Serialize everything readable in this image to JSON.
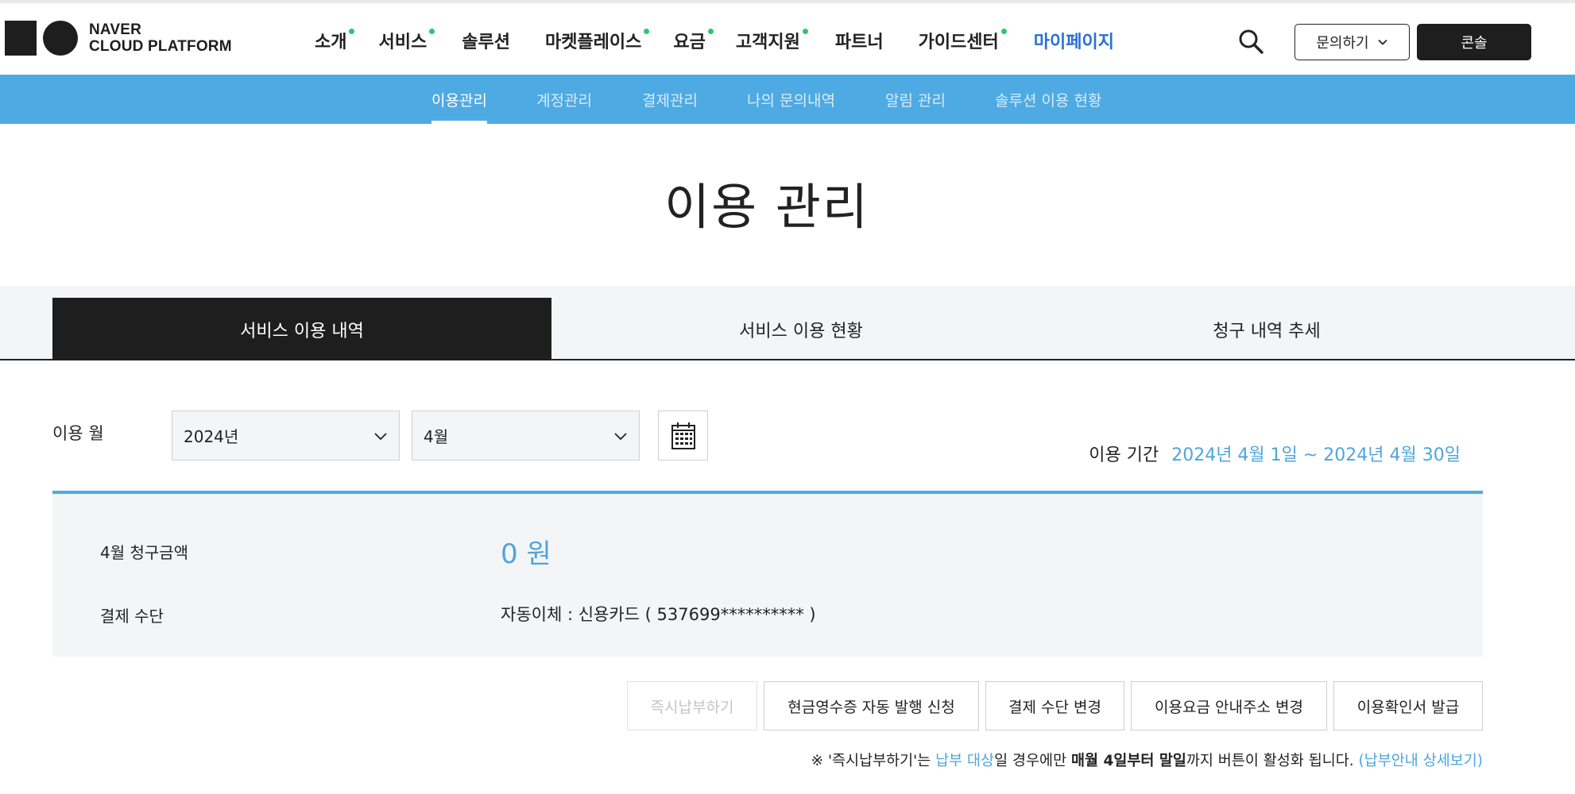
{
  "brand": {
    "line1": "NAVER",
    "line2": "CLOUD PLATFORM"
  },
  "gnb": {
    "items": [
      {
        "label": "소개",
        "dot": true
      },
      {
        "label": "서비스",
        "dot": true
      },
      {
        "label": "솔루션",
        "dot": false
      },
      {
        "label": "마켓플레이스",
        "dot": true
      },
      {
        "label": "요금",
        "dot": true
      },
      {
        "label": "고객지원",
        "dot": true
      },
      {
        "label": "파트너",
        "dot": false
      },
      {
        "label": "가이드센터",
        "dot": true
      },
      {
        "label": "마이페이지",
        "dot": false,
        "active": true
      }
    ],
    "inquiry_label": "문의하기",
    "console_label": "콘솔"
  },
  "subnav": {
    "items": [
      {
        "label": "이용관리",
        "active": true
      },
      {
        "label": "계정관리"
      },
      {
        "label": "결제관리"
      },
      {
        "label": "나의 문의내역"
      },
      {
        "label": "알림 관리"
      },
      {
        "label": "솔루션 이용 현황"
      }
    ]
  },
  "page_title": "이용 관리",
  "tabs": [
    {
      "label": "서비스 이용 내역",
      "active": true
    },
    {
      "label": "서비스 이용 현황"
    },
    {
      "label": "청구 내역 추세"
    }
  ],
  "filter": {
    "label": "이용 월",
    "year": "2024년",
    "month": "4월",
    "period_label": "이용 기간",
    "period_value": "2024년 4월 1일 ~ 2024년 4월 30일"
  },
  "summary": {
    "amount_label": "4월 청구금액",
    "amount_value": "0 원",
    "payment_label": "결제 수단",
    "payment_value": "자동이체 : 신용카드 ( 537699********** )"
  },
  "actions": {
    "pay_now": "즉시납부하기",
    "cash_receipt": "현금영수증 자동 발행 신청",
    "change_payment": "결제 수단 변경",
    "change_address": "이용요금 안내주소 변경",
    "usage_certificate": "이용확인서 발급"
  },
  "notice": {
    "prefix": "※ '즉시납부하기'는 ",
    "link1": "납부 대상",
    "mid1": "일 경우에만 ",
    "bold1": "매월 4일부터 말일",
    "suffix": "까지 버튼이 활성화 됩니다. ",
    "link2": "(납부안내 상세보기)"
  },
  "colors": {
    "accent_blue": "#4eaae3",
    "active_nav": "#2b6fd6",
    "dark": "#1e1e1e",
    "dot_green": "#2fc76a"
  }
}
